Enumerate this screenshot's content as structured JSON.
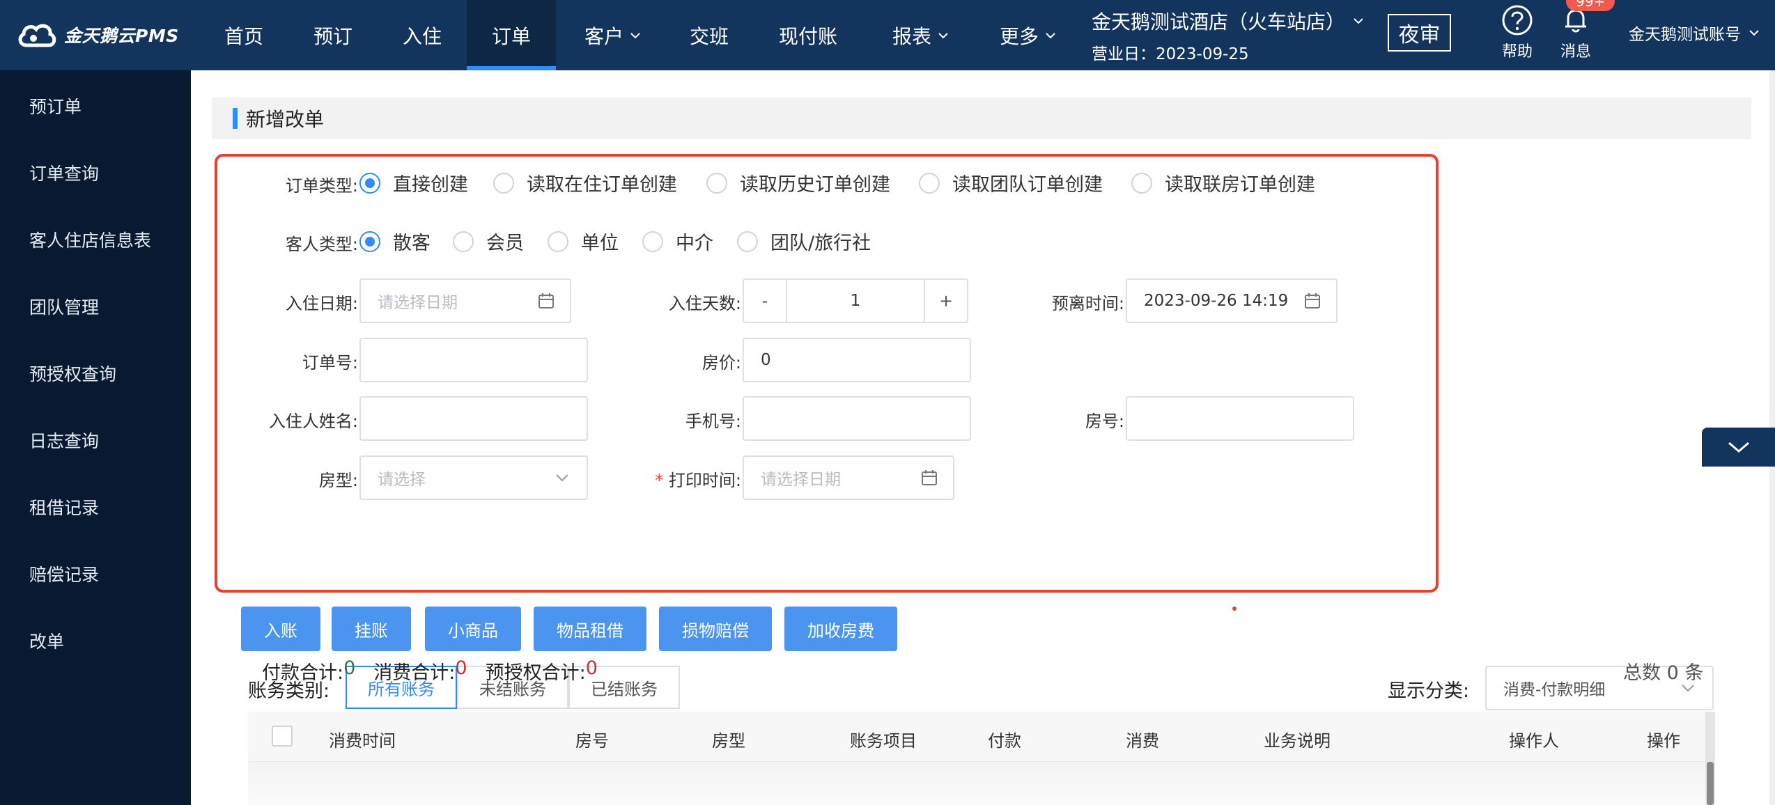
{
  "brand": {
    "logo_text": "金天鹅云PMS"
  },
  "nav": {
    "items": [
      {
        "label": "首页"
      },
      {
        "label": "预订"
      },
      {
        "label": "入住"
      },
      {
        "label": "订单"
      },
      {
        "label": "客户"
      },
      {
        "label": "交班"
      },
      {
        "label": "现付账"
      },
      {
        "label": "报表"
      },
      {
        "label": "更多"
      }
    ],
    "active": "订单"
  },
  "hotel": {
    "name": "金天鹅测试酒店（火车站店）",
    "business_day": "营业日：2023-09-25"
  },
  "night_audit": "夜审",
  "help": "帮助",
  "messages": {
    "label": "消息",
    "badge": "99+"
  },
  "account": "金天鹅测试账号",
  "sidebar": {
    "items": [
      {
        "label": "预订单"
      },
      {
        "label": "订单查询"
      },
      {
        "label": "客人住店信息表"
      },
      {
        "label": "团队管理"
      },
      {
        "label": "预授权查询"
      },
      {
        "label": "日志查询"
      },
      {
        "label": "租借记录"
      },
      {
        "label": "赔偿记录"
      },
      {
        "label": "改单"
      }
    ]
  },
  "section_title": "新增改单",
  "form": {
    "order_type": {
      "label": "订单类型:",
      "options": [
        "直接创建",
        "读取在住订单创建",
        "读取历史订单创建",
        "读取团队订单创建",
        "读取联房订单创建"
      ],
      "selected": "直接创建"
    },
    "guest_type": {
      "label": "客人类型:",
      "options": [
        "散客",
        "会员",
        "单位",
        "中介",
        "团队/旅行社"
      ],
      "selected": "散客"
    },
    "checkin_date": {
      "label": "入住日期:",
      "placeholder": "请选择日期",
      "value": ""
    },
    "stay_days": {
      "label": "入住天数:",
      "value": "1",
      "minus": "-",
      "plus": "+"
    },
    "checkout_time": {
      "label": "预离时间:",
      "value": "2023-09-26 14:19"
    },
    "order_no": {
      "label": "订单号:",
      "value": ""
    },
    "room_price": {
      "label": "房价:",
      "value": "0"
    },
    "guest_name": {
      "label": "入住人姓名:",
      "value": ""
    },
    "phone": {
      "label": "手机号:",
      "value": ""
    },
    "room_no": {
      "label": "房号:",
      "value": ""
    },
    "room_type": {
      "label": "房型:",
      "placeholder": "请选择"
    },
    "print_time": {
      "label": "打印时间:",
      "required_mark": "*",
      "placeholder": "请选择日期"
    }
  },
  "actions": [
    "入账",
    "挂账",
    "小商品",
    "物品租借",
    "损物赔偿",
    "加收房费"
  ],
  "account_filter": {
    "label": "账务类别:",
    "options": [
      "所有账务",
      "未结账务",
      "已结账务"
    ],
    "selected": "所有账务"
  },
  "display_category": {
    "label": "显示分类:",
    "value": "消费-付款明细"
  },
  "totals": {
    "payment_label": "付款合计:",
    "payment_value": "0",
    "consumption_label": "消费合计:",
    "consumption_value": "0",
    "preauth_label": "预授权合计:",
    "preauth_value": "0"
  },
  "total_count": "总数 0 条",
  "table": {
    "columns": [
      "消费时间",
      "房号",
      "房型",
      "账务项目",
      "付款",
      "消费",
      "业务说明",
      "操作人",
      "操作"
    ]
  },
  "colors": {
    "topbar": "#13345c",
    "sidebar": "#071a31",
    "accent": "#2f8cff",
    "highlight": "#e8412f",
    "button": "#4b95f0"
  }
}
